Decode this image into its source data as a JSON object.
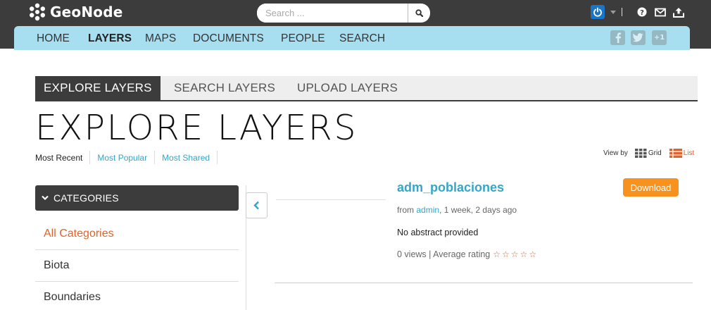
{
  "header": {
    "brand": "GeoNode",
    "search": {
      "placeholder": "Search ..."
    },
    "colors": {
      "bar": "#3c3c3c",
      "nav": "#a8dff0",
      "link": "#35a6c7",
      "accent": "#e2622b",
      "download": "#f7921e"
    },
    "icons": [
      "power-icon",
      "help-icon",
      "mail-icon",
      "upload-icon"
    ]
  },
  "nav": {
    "items": [
      "HOME",
      "LAYERS",
      "MAPS",
      "DOCUMENTS",
      "PEOPLE",
      "SEARCH"
    ],
    "active": "LAYERS",
    "plus_one": "+1"
  },
  "tabs": [
    "EXPLORE LAYERS",
    "SEARCH LAYERS",
    "UPLOAD LAYERS"
  ],
  "page": {
    "title": "EXPLORE LAYERS",
    "sort": [
      "Most Recent",
      "Most Popular",
      "Most Shared"
    ],
    "view_by": {
      "label": "View by",
      "grid": "Grid",
      "list": "List"
    }
  },
  "categories": {
    "heading": "CATEGORIES",
    "items": [
      "All Categories",
      "Biota",
      "Boundaries"
    ]
  },
  "result": {
    "title": "adm_poblaciones",
    "download_label": "Download",
    "from_prefix": "from",
    "owner": "admin",
    "time": ", 1 week, 2 days ago",
    "abstract": "No abstract provided",
    "stats": "0 views | Average rating",
    "rating": 0,
    "rating_max": 5
  }
}
